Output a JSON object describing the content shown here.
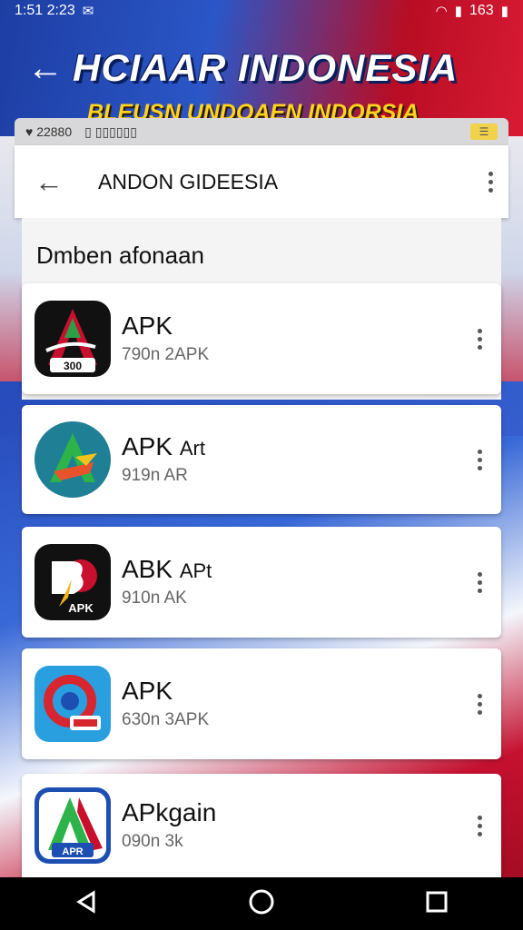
{
  "status_bar": {
    "time": "1:51 2:23",
    "battery_text": "163"
  },
  "hero": {
    "title": "HCIAAR INDONESIA",
    "subtitle": "BLEUSN UNDOAEN INDORSIA"
  },
  "mini_bar": {
    "left_text": "♥ 22880",
    "mid_text": "▯ ▯▯▯▯▯▯"
  },
  "app_bar": {
    "title": "ANDON GIDEESIA"
  },
  "section": {
    "title": "Dmben afonaan"
  },
  "apps": [
    {
      "name": "APK",
      "name_suffix": "",
      "meta": "790n 2APK",
      "icon": "apk-red-a-icon"
    },
    {
      "name": "APK",
      "name_suffix": "Art",
      "meta": "919n AR",
      "icon": "apk-teal-a-icon"
    },
    {
      "name": "ABK",
      "name_suffix": "APt",
      "meta": "910n AK",
      "icon": "apk-black-b-icon"
    },
    {
      "name": "APK",
      "name_suffix": "",
      "meta": "630n 3APK",
      "icon": "apk-blue-g-icon"
    },
    {
      "name": "APkgain",
      "name_suffix": "",
      "meta": "090n 3k",
      "icon": "apk-flag-a-icon"
    }
  ],
  "icon_labels": {
    "icon1": "300",
    "icon3": "APK",
    "icon5": "APR"
  },
  "colors": {
    "flag_red": "#c8102e",
    "flag_blue": "#1e4bc0",
    "title_yellow": "#ffd21f"
  }
}
